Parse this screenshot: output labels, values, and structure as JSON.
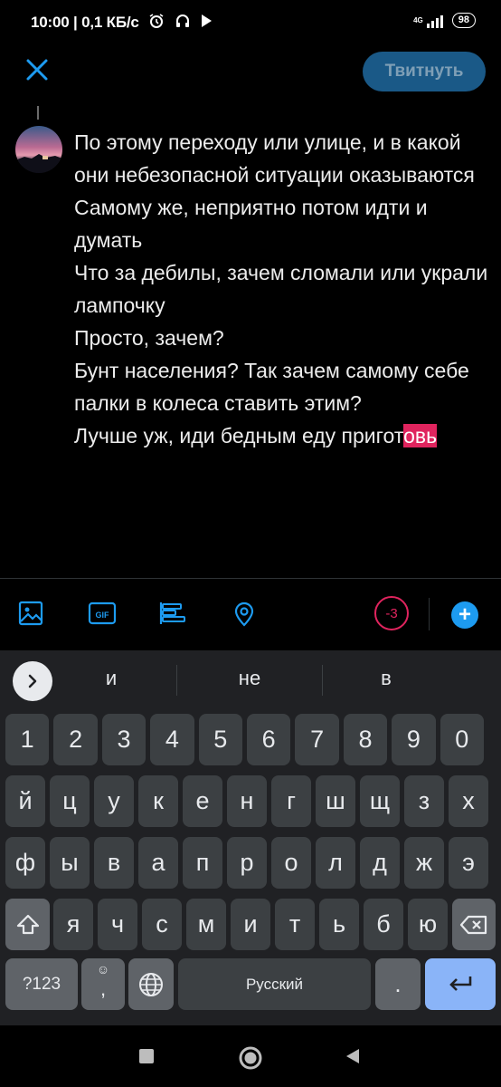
{
  "status_bar": {
    "time": "10:00",
    "speed": "0,1 КБ/с",
    "network": "4G",
    "battery": "98"
  },
  "header": {
    "tweet_label": "Твитнуть"
  },
  "compose": {
    "lines": [
      "По этому переходу или улице, и в какой они небезопасной ситуации оказываются",
      "Самому же, неприятно потом идти и думать",
      "Что за дебилы, зачем сломали или украли лампочку",
      "Просто, зачем?",
      "Бунт населения? Так зачем самому себе палки в колеса ставить этим?"
    ],
    "last_line_main": "Лучше уж, иди бедным еду пригот",
    "last_line_overflow": "овь"
  },
  "toolbar": {
    "char_count": "-3",
    "add_label": "+",
    "gif_label": "GIF"
  },
  "keyboard": {
    "suggestions": [
      "и",
      "не",
      "в"
    ],
    "row_numbers": [
      "1",
      "2",
      "3",
      "4",
      "5",
      "6",
      "7",
      "8",
      "9",
      "0"
    ],
    "row1": [
      "й",
      "ц",
      "у",
      "к",
      "е",
      "н",
      "г",
      "ш",
      "щ",
      "з",
      "х"
    ],
    "row2": [
      "ф",
      "ы",
      "в",
      "а",
      "п",
      "р",
      "о",
      "л",
      "д",
      "ж",
      "э"
    ],
    "row3": [
      "я",
      "ч",
      "с",
      "м",
      "и",
      "т",
      "ь",
      "б",
      "ю"
    ],
    "symbols_label": "?123",
    "comma_label": ",",
    "space_label": "Русский",
    "period_label": "."
  },
  "colors": {
    "accent": "#1d9bf0",
    "tweet_button": "#1a5987",
    "overflow": "#e0245e",
    "keyboard_bg": "#202124",
    "enter": "#8ab4f8"
  }
}
